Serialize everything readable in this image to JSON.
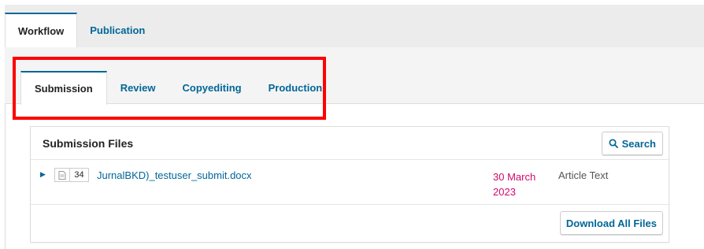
{
  "top_tabs": [
    {
      "label": "Workflow",
      "active": true
    },
    {
      "label": "Publication",
      "active": false
    }
  ],
  "stage_tabs": [
    {
      "label": "Submission",
      "active": true
    },
    {
      "label": "Review",
      "active": false
    },
    {
      "label": "Copyediting",
      "active": false
    },
    {
      "label": "Production",
      "active": false
    }
  ],
  "files": {
    "title": "Submission Files",
    "search_label": "Search",
    "download_all_label": "Download All Files",
    "rows": [
      {
        "id": "34",
        "name": "JurnalBKD)_testuser_submit.docx",
        "date_line1": "30 March",
        "date_line2": "2023",
        "genre": "Article Text"
      }
    ]
  },
  "colors": {
    "link": "#006798",
    "date": "#d00a6c",
    "highlight": "#ff0000"
  },
  "icons": {
    "expander": "triangle-right-icon",
    "file_type": "document-icon",
    "search": "search-icon"
  }
}
